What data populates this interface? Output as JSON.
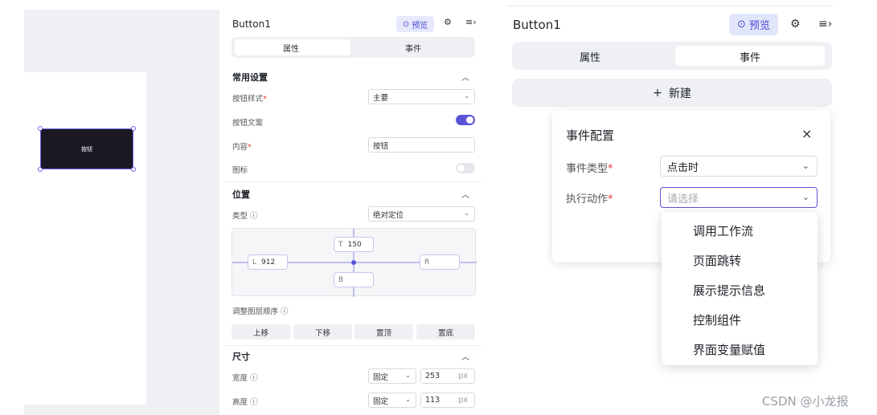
{
  "left": {
    "canvas_button_label": "按钮",
    "header": {
      "title": "Button1",
      "preview_label": "预览"
    },
    "tabs": [
      {
        "label": "属性",
        "active": true
      },
      {
        "label": "事件",
        "active": false
      }
    ],
    "common": {
      "title": "常用设置",
      "style_label": "按钮样式",
      "style_value": "主要",
      "text_label": "按钮文案",
      "text_enabled": true,
      "content_label": "内容",
      "content_value": "按钮",
      "icon_label": "图标",
      "icon_enabled": false
    },
    "position": {
      "title": "位置",
      "type_label": "类型",
      "type_value": "绝对定位",
      "top_tag": "T",
      "top_value": "150",
      "left_tag": "L",
      "left_value": "912",
      "right_tag": "R",
      "right_value": "",
      "bottom_tag": "B",
      "bottom_value": "",
      "layer_label": "调整图层顺序",
      "layer_buttons": [
        "上移",
        "下移",
        "置顶",
        "置底"
      ]
    },
    "size": {
      "title": "尺寸",
      "width_label": "宽度",
      "width_mode": "固定",
      "width_value": "253",
      "height_label": "高度",
      "height_mode": "固定",
      "height_value": "113",
      "unit": "px"
    }
  },
  "right": {
    "header": {
      "title": "Button1",
      "preview_label": "预览"
    },
    "tabs": [
      {
        "label": "属性",
        "active": false
      },
      {
        "label": "事件",
        "active": true
      }
    ],
    "new_button": "新建",
    "event_config": {
      "title": "事件配置",
      "type_label": "事件类型",
      "type_value": "点击时",
      "action_label": "执行动作",
      "action_placeholder": "请选择",
      "action_options": [
        "调用工作流",
        "页面跳转",
        "展示提示信息",
        "控制组件",
        "界面变量赋值"
      ]
    }
  },
  "watermark": "CSDN @小龙报",
  "colors": {
    "accent": "#5b54d8",
    "preview_bg": "#e2e6fb",
    "required": "#e53935"
  },
  "icons": [
    "play-circle-icon",
    "gear-icon",
    "panel-collapse-icon",
    "chevron-up-icon",
    "chevron-down-icon",
    "info-icon",
    "plus-icon",
    "close-icon"
  ]
}
